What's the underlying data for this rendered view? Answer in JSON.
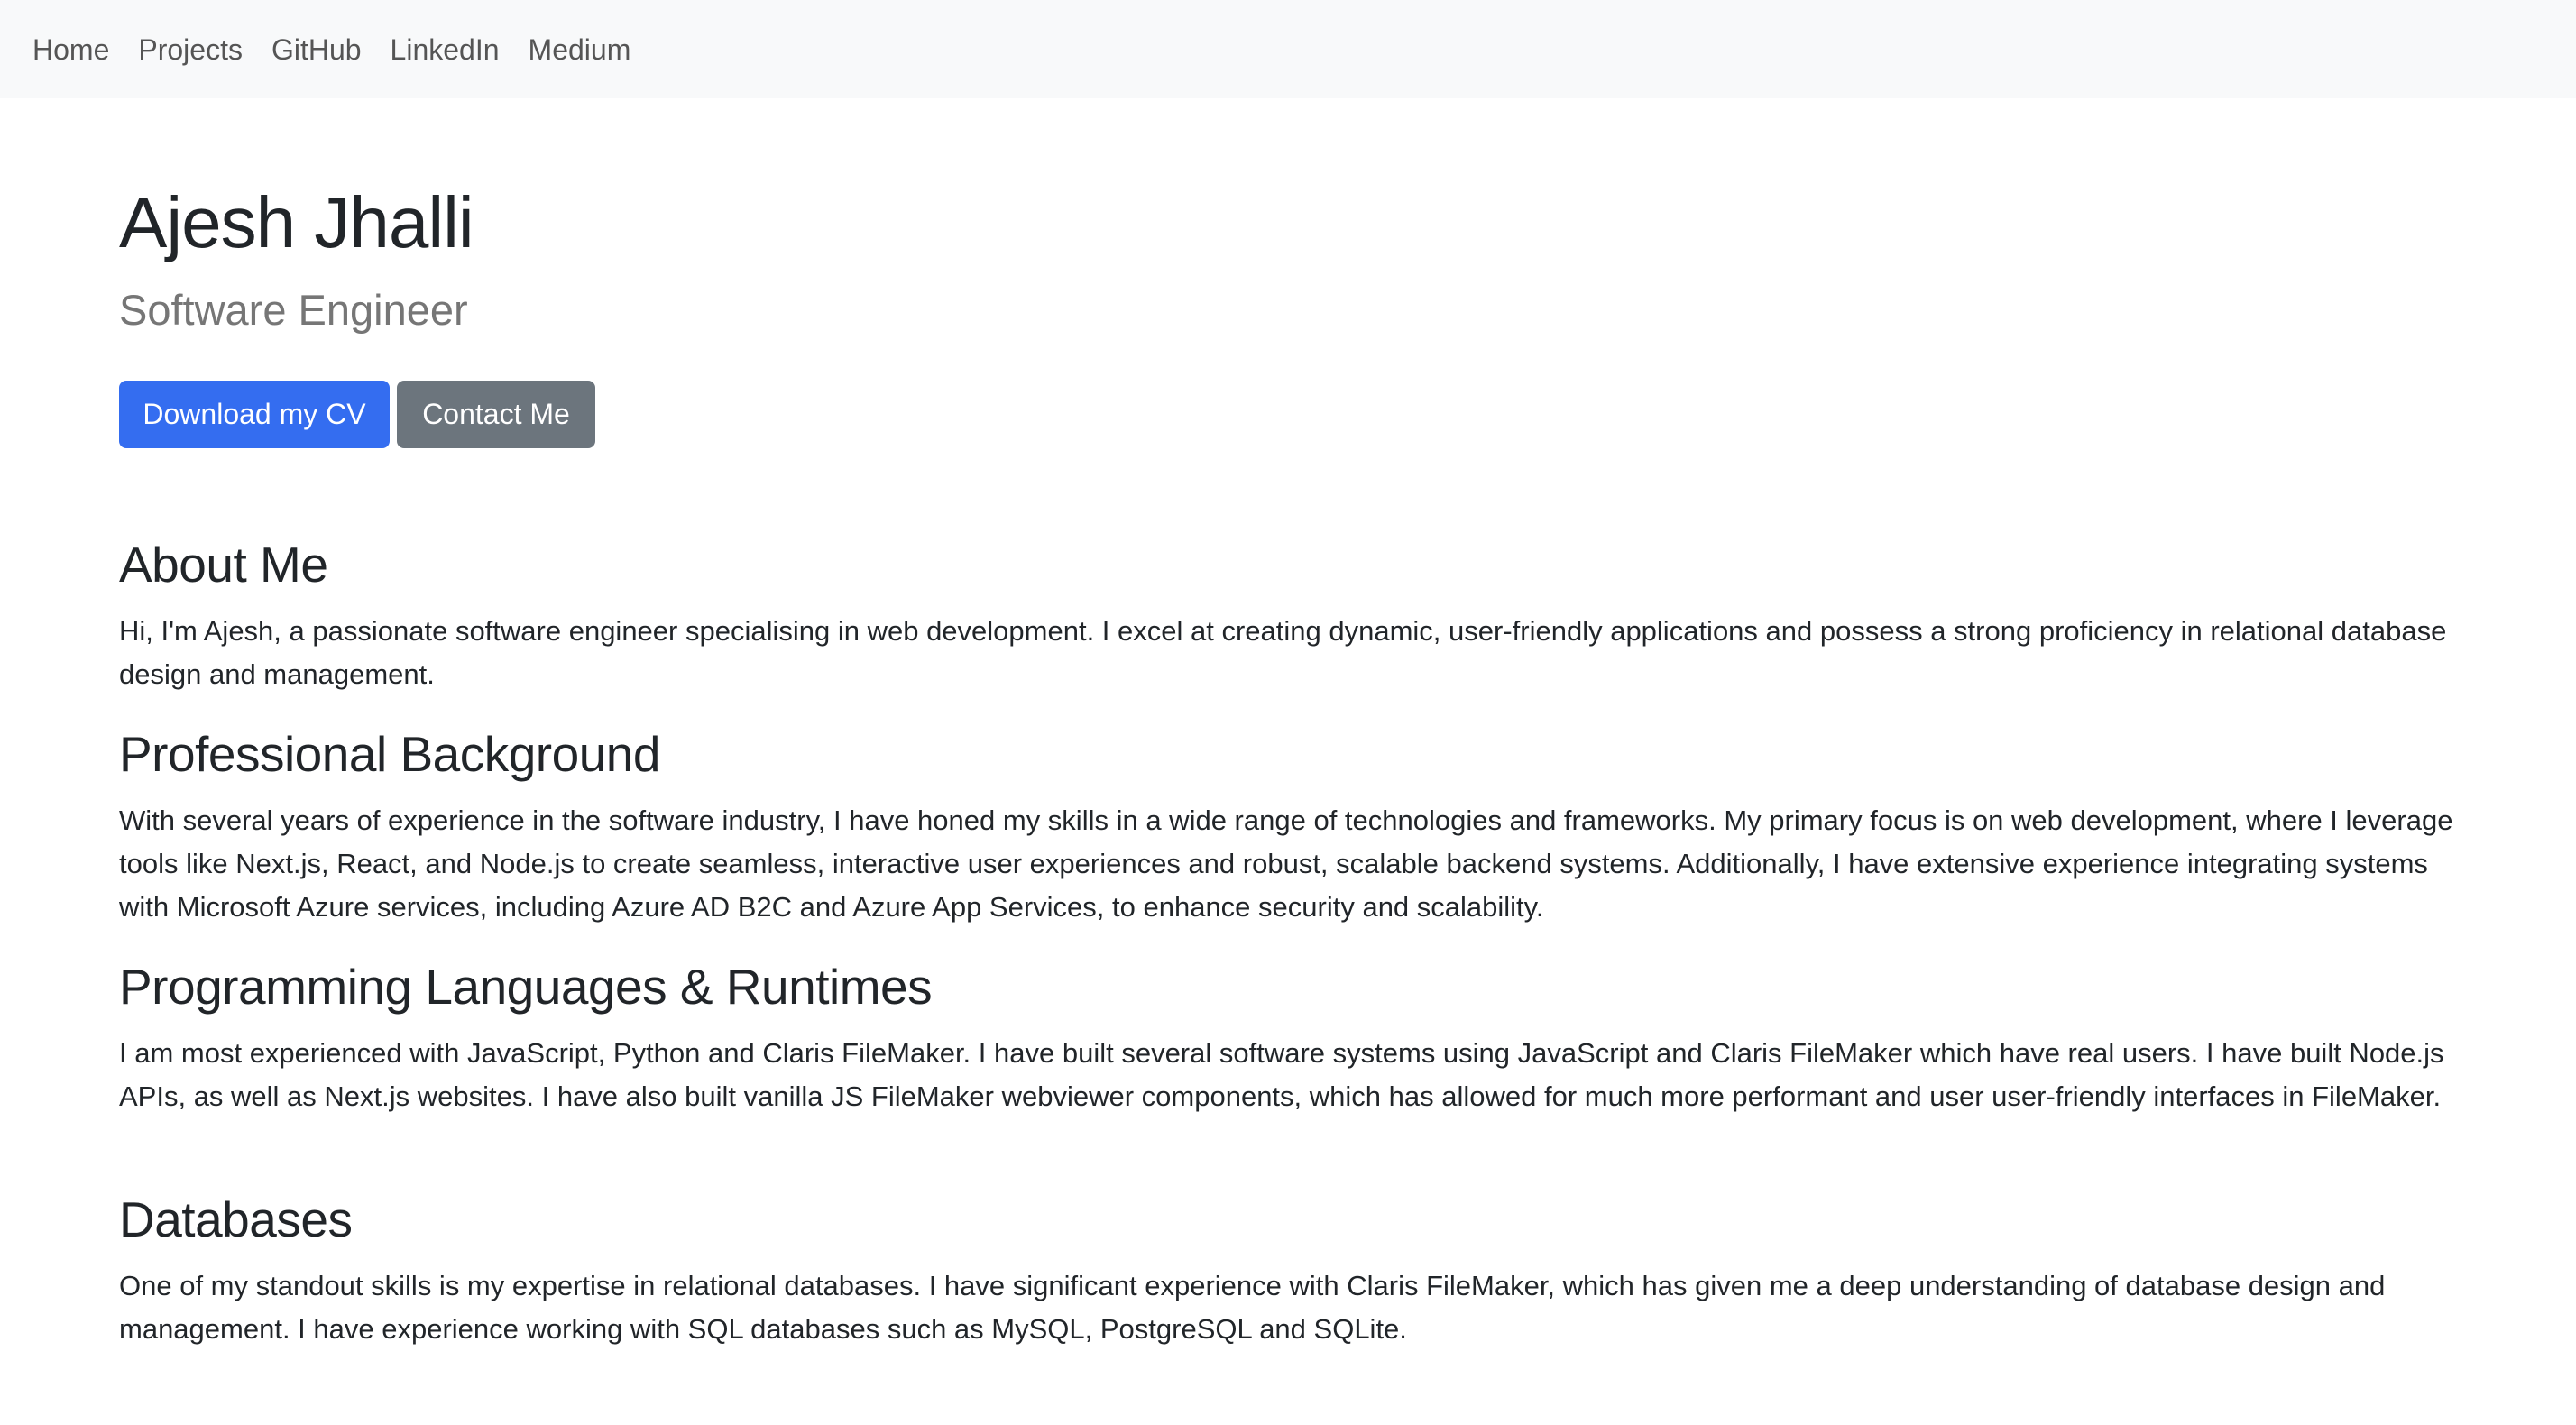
{
  "nav": {
    "items": [
      {
        "label": "Home"
      },
      {
        "label": "Projects"
      },
      {
        "label": "GitHub"
      },
      {
        "label": "LinkedIn"
      },
      {
        "label": "Medium"
      }
    ]
  },
  "hero": {
    "name": "Ajesh Jhalli",
    "title": "Software Engineer",
    "buttons": {
      "download_cv": "Download my CV",
      "contact": "Contact Me"
    }
  },
  "colors": {
    "primary": "#346df0",
    "secondary": "#6c757d",
    "navbar_bg": "#f8f9fa",
    "text": "#212529",
    "muted": "#767676"
  },
  "sections": [
    {
      "heading": "About Me",
      "body": "Hi, I'm Ajesh, a passionate software engineer specialising in web development. I excel at creating dynamic, user-friendly applications and possess a strong proficiency in relational database design and management."
    },
    {
      "heading": "Professional Background",
      "body": "With several years of experience in the software industry, I have honed my skills in a wide range of technologies and frameworks. My primary focus is on web development, where I leverage tools like Next.js, React, and Node.js to create seamless, interactive user experiences and robust, scalable backend systems. Additionally, I have extensive experience integrating systems with Microsoft Azure services, including Azure AD B2C and Azure App Services, to enhance security and scalability."
    },
    {
      "heading": "Programming Languages & Runtimes",
      "body": "I am most experienced with JavaScript, Python and Claris FileMaker. I have built several software systems using JavaScript and Claris FileMaker which have real users. I have built Node.js APIs, as well as Next.js websites. I have also built vanilla JS FileMaker webviewer components, which has allowed for much more performant and user user-friendly interfaces in FileMaker."
    },
    {
      "heading": "Databases",
      "body": "One of my standout skills is my expertise in relational databases. I have significant experience with Claris FileMaker, which has given me a deep understanding of database design and management. I have experience working with SQL databases such as MySQL, PostgreSQL and SQLite."
    }
  ]
}
